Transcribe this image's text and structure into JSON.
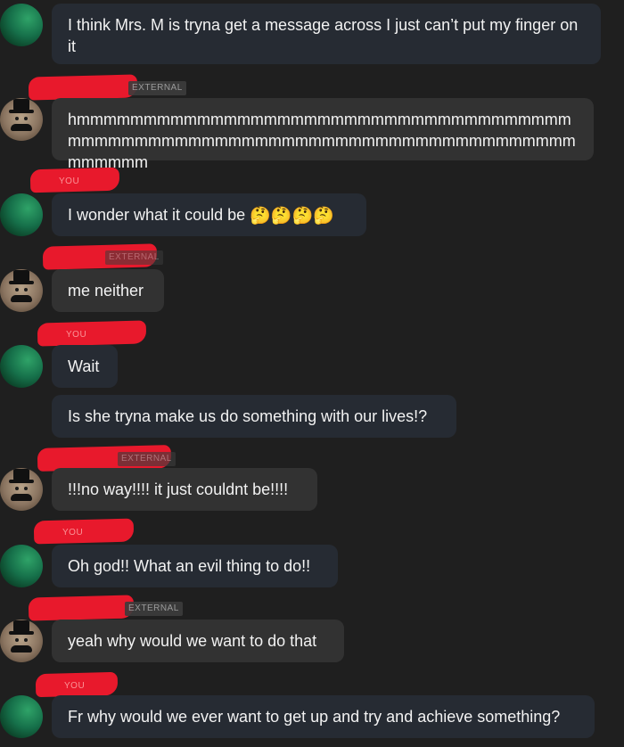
{
  "messages": [
    {
      "sender": "me",
      "text": "I think Mrs. M  is tryna get a message across I just can’t put my finger on it"
    },
    {
      "sender": "other",
      "tag": "EXTERNAL",
      "text": "hmmmmmmmmmmmmmmmmmmmmmmmmmmmmmmmmmmmmmmmmmmmmmmmmmmmmmmmmmmmmmmmmmmmmmmmmmmmmmmmmm"
    },
    {
      "sender": "me",
      "tag": "You",
      "text": "I wonder what it could be",
      "emoji": "🤔🤔🤔🤔"
    },
    {
      "sender": "other",
      "tag": "EXTERNAL",
      "text": "me neither"
    },
    {
      "sender": "me",
      "tag": "You",
      "text": "Wait"
    },
    {
      "sender": "me",
      "text": "Is she tryna make us do something with our lives!?"
    },
    {
      "sender": "other",
      "tag": "EXTERNAL",
      "text": "!!!no way!!!! it just couldnt be!!!!"
    },
    {
      "sender": "me",
      "tag": "You",
      "text": "Oh god!! What an evil thing to do!!"
    },
    {
      "sender": "other",
      "tag": "EXTERNAL",
      "text": "yeah why would we want to do that"
    },
    {
      "sender": "me",
      "tag": "You",
      "text": "Fr why would we ever want to get up and try and achieve something?"
    }
  ],
  "colors": {
    "background": "#1f1f1f",
    "my_bubble": "#262b33",
    "other_bubble": "#323232",
    "redaction": "#e8192c",
    "text": "#f2f2f2"
  },
  "icons": {
    "me_avatar": "green-fabric-avatar",
    "other_avatar": "top-hat-mustache-avatar"
  }
}
